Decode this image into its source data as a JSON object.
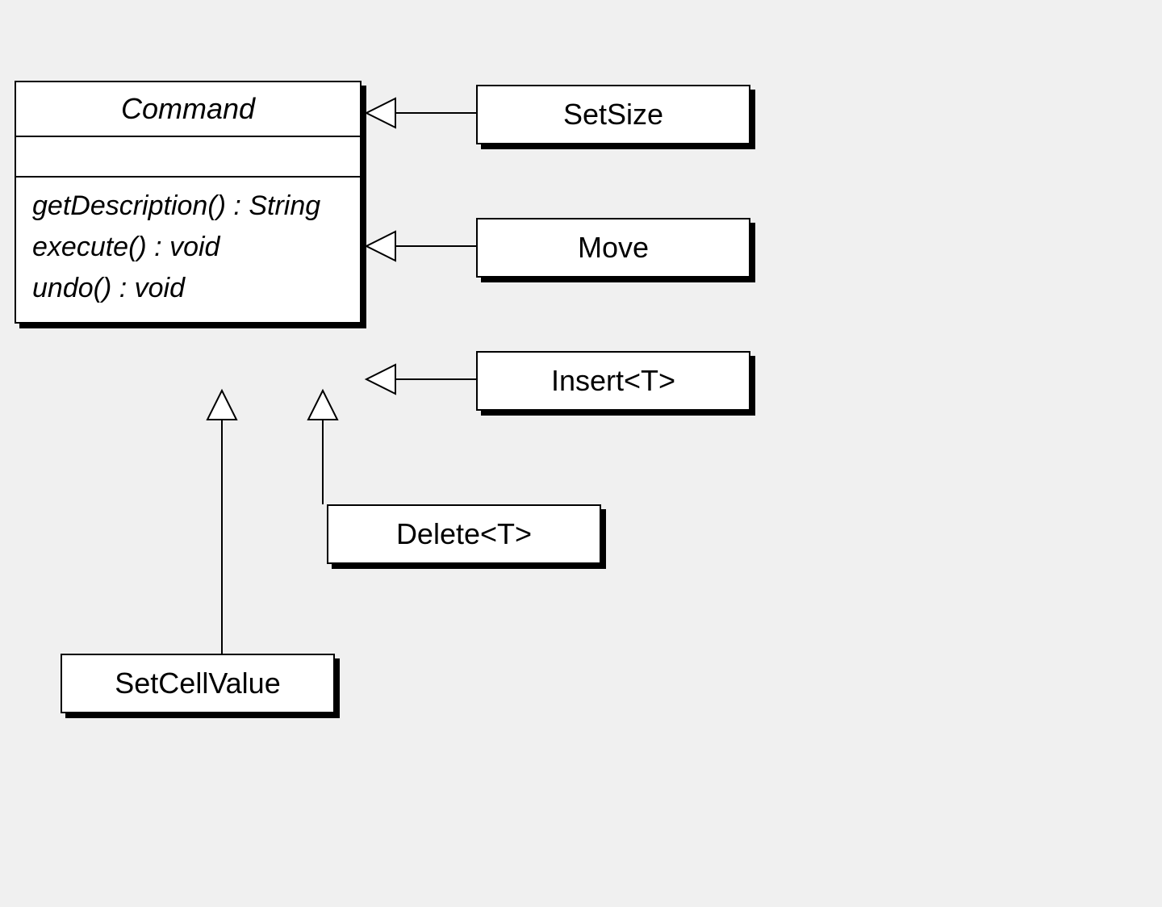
{
  "diagram": {
    "base_class": {
      "name": "Command",
      "methods": [
        "getDescription() : String",
        "execute() : void",
        "undo() : void"
      ]
    },
    "subclasses": {
      "setsize": "SetSize",
      "move": "Move",
      "insert": "Insert<T>",
      "delete": "Delete<T>",
      "setcellvalue": "SetCellValue"
    }
  }
}
